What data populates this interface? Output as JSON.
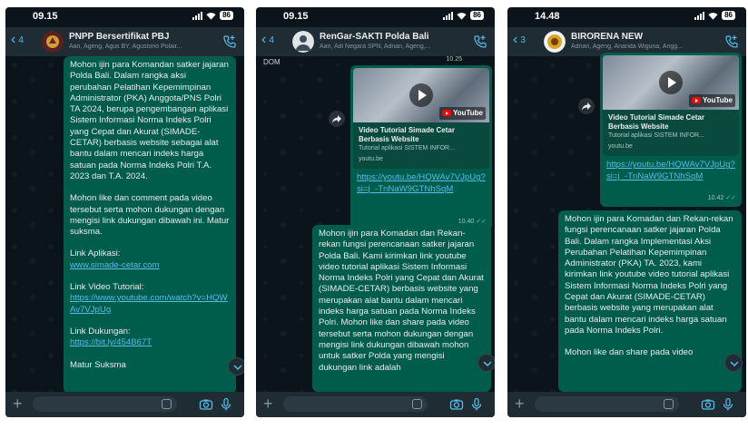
{
  "screens": [
    {
      "time": "09.15",
      "battery": "86",
      "back_count": "4",
      "title": "PNPP Bersertifikat PBJ",
      "subtitle": "Aan, Ageng, Agus BY, Agustono Polair...",
      "message": {
        "para1": "Mohon ijin para Komandan satker jajaran Polda Bali. Dalam rangka aksi perubahan Pelatihan Kepemimpinan Administrator (PKA) Anggota/PNS Polri TA 2024, berupa pengembangan aplikasi Sistem Informasi Norma Indeks Polri yang Cepat dan Akurat (SIMADE-CETAR) berbasis website sebagai alat bantu dalam mencari indeks harga satuan pada Norma Indeks Polri T.A. 2023 dan T.A. 2024.",
        "para2": "Mohon like dan comment pada video tersebut serta mohon dukungan dengan mengisi link dukungan dibawah ini. Matur suksma.",
        "app_label": "Link Aplikasi:",
        "app_link": "www.simade-cetar.com",
        "video_label": "Link Video Tutorial:",
        "video_link": "https://www.youtube.com/watch?v=HQWAv7VJpUg",
        "support_label": "Link Dukungan:",
        "support_link": "https://bit.ly/454B67T",
        "cut_off": "Matur Suksma"
      }
    },
    {
      "time": "09.15",
      "battery": "86",
      "back_count": "4",
      "title": "RenGar-SAKTI Polda Bali",
      "subtitle": "Aan, Adi Negara SPN, Adnan, Ageng,...",
      "top_fragment": "DOM",
      "top_time": "10.25",
      "preview": {
        "title": "Video Tutorial Simade Cetar Berbasis Website",
        "desc": "Tutorial aplikasi SISTEM INFOR...",
        "domain": "youtu.be",
        "yt_label": "YouTube"
      },
      "link": "https://youtu.be/HQWAv7VJpUg?si=j_-TnNaW9GTNhSqM",
      "link_time": "10.40",
      "message": "Mohon ijin para Komadan dan Rekan-rekan fungsi perencanaan satker jajaran Polda Bali. Kami kirimkan link youtube video tutorial aplikasi Sistem Informasi Norma Indeks Polri yang Cepat dan Akurat (SIMADE-CETAR) berbasis website yang merupakan alat bantu dalam mencari indeks harga satuan pada Norma Indeks Polri. Mohon like dan share pada video tersebut serta mohon dukungan dengan mengisi link dukungan dibawah mohon untuk satker Polda yang mengisi dukungan link adalah"
    },
    {
      "time": "14.48",
      "battery": "86",
      "back_count": "3",
      "title": "BIRORENA NEW",
      "subtitle": "Adnan, Ageng, Ananda Wiguna, Angg...",
      "preview": {
        "title": "Video Tutorial Simade Cetar Berbasis Website",
        "desc": "Tutorial aplikasi SISTEM INFOR...",
        "domain": "youtu.be",
        "yt_label": "YouTube"
      },
      "link": "https://youtu.be/HQWAv7VJpUg?si=j_-TnNaW9GTNhSqM",
      "link_time": "10.42",
      "message1": "Mohon ijin para Komadan dan Rekan-rekan fungsi perencanaan satker jajaran Polda Bali. Dalam rangka Implementasi Aksi Perubahan Pelatihan Kepemimpinan Administrator (PKA) TA. 2023, kami kirimkan link youtube video tutorial aplikasi Sistem Informasi Norma Indeks Polri yang Cepat dan Akurat (SIMADE-CETAR) berbasis website yang merupakan alat bantu dalam mencari indeks harga satuan pada Norma Indeks Polri.",
      "message2": "Mohon like dan share pada video"
    }
  ],
  "colors": {
    "outgoing_bubble": "#005c4b",
    "header": "#1f2c34",
    "link": "#53bdeb",
    "background": "#0b141a"
  },
  "icons": [
    "back-chevron-icon",
    "add-call-icon",
    "plus-icon",
    "sticker-icon",
    "camera-icon",
    "microphone-icon",
    "forward-icon",
    "scroll-down-icon",
    "play-icon",
    "youtube-logo-icon"
  ]
}
